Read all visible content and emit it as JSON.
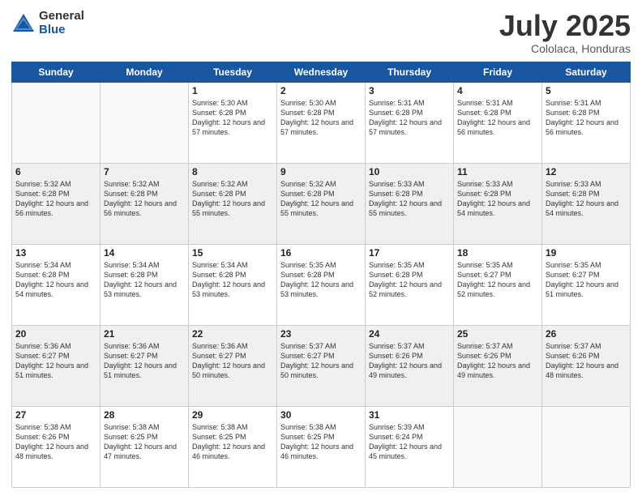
{
  "logo": {
    "general": "General",
    "blue": "Blue"
  },
  "title": "July 2025",
  "subtitle": "Cololaca, Honduras",
  "days_of_week": [
    "Sunday",
    "Monday",
    "Tuesday",
    "Wednesday",
    "Thursday",
    "Friday",
    "Saturday"
  ],
  "weeks": [
    {
      "shaded": false,
      "days": [
        {
          "num": "",
          "info": ""
        },
        {
          "num": "",
          "info": ""
        },
        {
          "num": "1",
          "info": "Sunrise: 5:30 AM\nSunset: 6:28 PM\nDaylight: 12 hours and 57 minutes."
        },
        {
          "num": "2",
          "info": "Sunrise: 5:30 AM\nSunset: 6:28 PM\nDaylight: 12 hours and 57 minutes."
        },
        {
          "num": "3",
          "info": "Sunrise: 5:31 AM\nSunset: 6:28 PM\nDaylight: 12 hours and 57 minutes."
        },
        {
          "num": "4",
          "info": "Sunrise: 5:31 AM\nSunset: 6:28 PM\nDaylight: 12 hours and 56 minutes."
        },
        {
          "num": "5",
          "info": "Sunrise: 5:31 AM\nSunset: 6:28 PM\nDaylight: 12 hours and 56 minutes."
        }
      ]
    },
    {
      "shaded": true,
      "days": [
        {
          "num": "6",
          "info": "Sunrise: 5:32 AM\nSunset: 6:28 PM\nDaylight: 12 hours and 56 minutes."
        },
        {
          "num": "7",
          "info": "Sunrise: 5:32 AM\nSunset: 6:28 PM\nDaylight: 12 hours and 56 minutes."
        },
        {
          "num": "8",
          "info": "Sunrise: 5:32 AM\nSunset: 6:28 PM\nDaylight: 12 hours and 55 minutes."
        },
        {
          "num": "9",
          "info": "Sunrise: 5:32 AM\nSunset: 6:28 PM\nDaylight: 12 hours and 55 minutes."
        },
        {
          "num": "10",
          "info": "Sunrise: 5:33 AM\nSunset: 6:28 PM\nDaylight: 12 hours and 55 minutes."
        },
        {
          "num": "11",
          "info": "Sunrise: 5:33 AM\nSunset: 6:28 PM\nDaylight: 12 hours and 54 minutes."
        },
        {
          "num": "12",
          "info": "Sunrise: 5:33 AM\nSunset: 6:28 PM\nDaylight: 12 hours and 54 minutes."
        }
      ]
    },
    {
      "shaded": false,
      "days": [
        {
          "num": "13",
          "info": "Sunrise: 5:34 AM\nSunset: 6:28 PM\nDaylight: 12 hours and 54 minutes."
        },
        {
          "num": "14",
          "info": "Sunrise: 5:34 AM\nSunset: 6:28 PM\nDaylight: 12 hours and 53 minutes."
        },
        {
          "num": "15",
          "info": "Sunrise: 5:34 AM\nSunset: 6:28 PM\nDaylight: 12 hours and 53 minutes."
        },
        {
          "num": "16",
          "info": "Sunrise: 5:35 AM\nSunset: 6:28 PM\nDaylight: 12 hours and 53 minutes."
        },
        {
          "num": "17",
          "info": "Sunrise: 5:35 AM\nSunset: 6:28 PM\nDaylight: 12 hours and 52 minutes."
        },
        {
          "num": "18",
          "info": "Sunrise: 5:35 AM\nSunset: 6:27 PM\nDaylight: 12 hours and 52 minutes."
        },
        {
          "num": "19",
          "info": "Sunrise: 5:35 AM\nSunset: 6:27 PM\nDaylight: 12 hours and 51 minutes."
        }
      ]
    },
    {
      "shaded": true,
      "days": [
        {
          "num": "20",
          "info": "Sunrise: 5:36 AM\nSunset: 6:27 PM\nDaylight: 12 hours and 51 minutes."
        },
        {
          "num": "21",
          "info": "Sunrise: 5:36 AM\nSunset: 6:27 PM\nDaylight: 12 hours and 51 minutes."
        },
        {
          "num": "22",
          "info": "Sunrise: 5:36 AM\nSunset: 6:27 PM\nDaylight: 12 hours and 50 minutes."
        },
        {
          "num": "23",
          "info": "Sunrise: 5:37 AM\nSunset: 6:27 PM\nDaylight: 12 hours and 50 minutes."
        },
        {
          "num": "24",
          "info": "Sunrise: 5:37 AM\nSunset: 6:26 PM\nDaylight: 12 hours and 49 minutes."
        },
        {
          "num": "25",
          "info": "Sunrise: 5:37 AM\nSunset: 6:26 PM\nDaylight: 12 hours and 49 minutes."
        },
        {
          "num": "26",
          "info": "Sunrise: 5:37 AM\nSunset: 6:26 PM\nDaylight: 12 hours and 48 minutes."
        }
      ]
    },
    {
      "shaded": false,
      "days": [
        {
          "num": "27",
          "info": "Sunrise: 5:38 AM\nSunset: 6:26 PM\nDaylight: 12 hours and 48 minutes."
        },
        {
          "num": "28",
          "info": "Sunrise: 5:38 AM\nSunset: 6:25 PM\nDaylight: 12 hours and 47 minutes."
        },
        {
          "num": "29",
          "info": "Sunrise: 5:38 AM\nSunset: 6:25 PM\nDaylight: 12 hours and 46 minutes."
        },
        {
          "num": "30",
          "info": "Sunrise: 5:38 AM\nSunset: 6:25 PM\nDaylight: 12 hours and 46 minutes."
        },
        {
          "num": "31",
          "info": "Sunrise: 5:39 AM\nSunset: 6:24 PM\nDaylight: 12 hours and 45 minutes."
        },
        {
          "num": "",
          "info": ""
        },
        {
          "num": "",
          "info": ""
        }
      ]
    }
  ]
}
